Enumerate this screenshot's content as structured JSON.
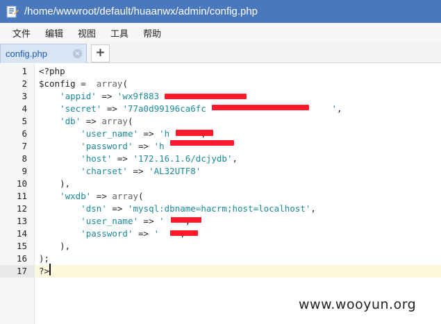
{
  "window": {
    "title": "/home/wwwroot/default/huaanwx/admin/config.php"
  },
  "menu": [
    "文件",
    "编辑",
    "视图",
    "工具",
    "帮助"
  ],
  "tabs": [
    {
      "label": "config.php",
      "close_symbol": "×"
    }
  ],
  "new_tab_symbol": "+",
  "editor": {
    "active_line": 17,
    "lines": [
      {
        "number": "1",
        "tokens": [
          {
            "t": "plain",
            "v": "<?php"
          }
        ]
      },
      {
        "number": "2",
        "tokens": [
          {
            "t": "plain",
            "v": "$config =  "
          },
          {
            "t": "kw",
            "v": "array"
          },
          {
            "t": "plain",
            "v": "("
          }
        ]
      },
      {
        "number": "3",
        "tokens": [
          {
            "t": "plain",
            "v": "    "
          },
          {
            "t": "str",
            "v": "'appid'"
          },
          {
            "t": "plain",
            "v": " => "
          },
          {
            "t": "str",
            "v": "'wx9f883"
          }
        ]
      },
      {
        "number": "4",
        "tokens": [
          {
            "t": "plain",
            "v": "    "
          },
          {
            "t": "str",
            "v": "'secret'"
          },
          {
            "t": "plain",
            "v": " => "
          },
          {
            "t": "str",
            "v": "'77a0d99196ca6fc"
          },
          {
            "t": "plain",
            "v": "                        "
          },
          {
            "t": "str",
            "v": "'"
          },
          {
            "t": "plain",
            "v": ","
          }
        ]
      },
      {
        "number": "5",
        "tokens": [
          {
            "t": "plain",
            "v": "    "
          },
          {
            "t": "str",
            "v": "'db'"
          },
          {
            "t": "plain",
            "v": " => "
          },
          {
            "t": "kw",
            "v": "array"
          },
          {
            "t": "plain",
            "v": "("
          }
        ]
      },
      {
        "number": "6",
        "tokens": [
          {
            "t": "plain",
            "v": "        "
          },
          {
            "t": "str",
            "v": "'user_name'"
          },
          {
            "t": "plain",
            "v": " => "
          },
          {
            "t": "str",
            "v": "'h"
          },
          {
            "t": "plain",
            "v": "      ,"
          }
        ]
      },
      {
        "number": "7",
        "tokens": [
          {
            "t": "plain",
            "v": "        "
          },
          {
            "t": "str",
            "v": "'password'"
          },
          {
            "t": "plain",
            "v": " => "
          },
          {
            "t": "str",
            "v": "'h"
          }
        ]
      },
      {
        "number": "8",
        "tokens": [
          {
            "t": "plain",
            "v": "        "
          },
          {
            "t": "str",
            "v": "'host'"
          },
          {
            "t": "plain",
            "v": " => "
          },
          {
            "t": "str",
            "v": "'172.16.1.6/dcjydb'"
          },
          {
            "t": "plain",
            "v": ","
          }
        ]
      },
      {
        "number": "9",
        "tokens": [
          {
            "t": "plain",
            "v": "        "
          },
          {
            "t": "str",
            "v": "'charset'"
          },
          {
            "t": "plain",
            "v": " => "
          },
          {
            "t": "str",
            "v": "'AL32UTF8'"
          }
        ]
      },
      {
        "number": "10",
        "tokens": [
          {
            "t": "plain",
            "v": "    ),"
          }
        ]
      },
      {
        "number": "11",
        "tokens": [
          {
            "t": "plain",
            "v": "    "
          },
          {
            "t": "str",
            "v": "'wxdb'"
          },
          {
            "t": "plain",
            "v": " => "
          },
          {
            "t": "kw",
            "v": "array"
          },
          {
            "t": "plain",
            "v": "("
          }
        ]
      },
      {
        "number": "12",
        "tokens": [
          {
            "t": "plain",
            "v": "        "
          },
          {
            "t": "str",
            "v": "'dsn'"
          },
          {
            "t": "plain",
            "v": " => "
          },
          {
            "t": "str",
            "v": "'mysql:dbname=hacrm;host=localhost'"
          },
          {
            "t": "plain",
            "v": ","
          }
        ]
      },
      {
        "number": "13",
        "tokens": [
          {
            "t": "plain",
            "v": "        "
          },
          {
            "t": "str",
            "v": "'user_name'"
          },
          {
            "t": "plain",
            "v": " => "
          },
          {
            "t": "str",
            "v": "'"
          },
          {
            "t": "plain",
            "v": "    ,"
          }
        ]
      },
      {
        "number": "14",
        "tokens": [
          {
            "t": "plain",
            "v": "        "
          },
          {
            "t": "str",
            "v": "'password'"
          },
          {
            "t": "plain",
            "v": " => "
          },
          {
            "t": "str",
            "v": "'"
          },
          {
            "t": "plain",
            "v": "    ,"
          }
        ]
      },
      {
        "number": "15",
        "tokens": [
          {
            "t": "plain",
            "v": "    ),"
          }
        ]
      },
      {
        "number": "16",
        "tokens": [
          {
            "t": "plain",
            "v": ");"
          }
        ]
      },
      {
        "number": "17",
        "tokens": [
          {
            "t": "plain",
            "v": "?>"
          }
        ]
      }
    ]
  },
  "watermark": "www.wooyun.org",
  "colors": {
    "titlebar": "#4a78bd",
    "string": "#1a8a9a",
    "redaction": "#ff1b2d",
    "active_line": "#fdf8dc"
  }
}
